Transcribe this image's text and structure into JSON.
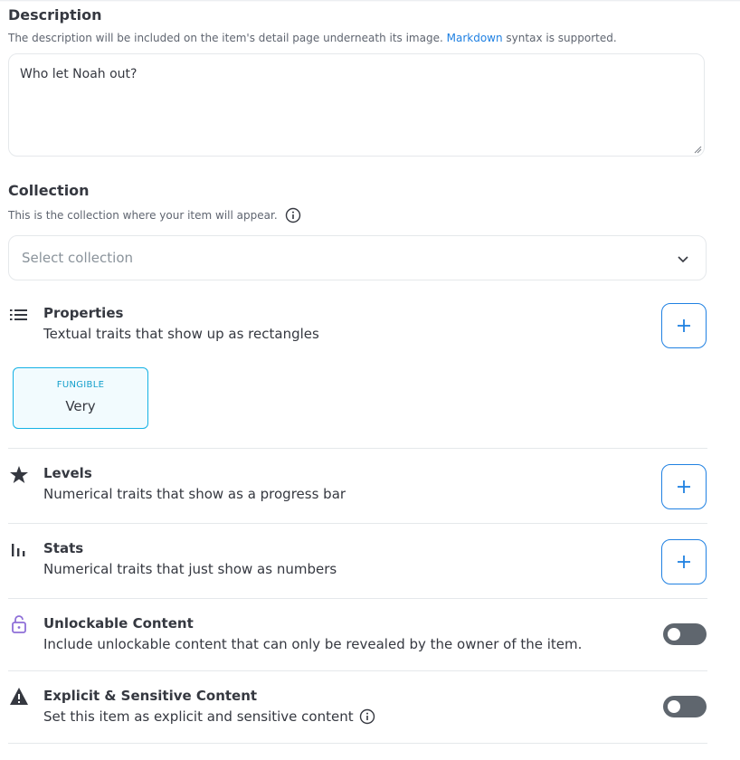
{
  "description": {
    "title": "Description",
    "helper_before_link": "The description will be included on the item's detail page underneath its image.",
    "helper_link": "Markdown",
    "helper_after_link": "syntax is supported.",
    "value": "Who let Noah out?"
  },
  "collection": {
    "title": "Collection",
    "helper": "This is the collection where your item will appear.",
    "select_placeholder": "Select collection"
  },
  "properties": {
    "title": "Properties",
    "subtitle": "Textual traits that show up as rectangles",
    "items": [
      {
        "type": "FUNGIBLE",
        "value": "Very"
      }
    ]
  },
  "levels": {
    "title": "Levels",
    "subtitle": "Numerical traits that show as a progress bar"
  },
  "stats": {
    "title": "Stats",
    "subtitle": "Numerical traits that just show as numbers"
  },
  "unlockable": {
    "title": "Unlockable Content",
    "subtitle": "Include unlockable content that can only be revealed by the owner of the item.",
    "enabled": false
  },
  "explicit": {
    "title": "Explicit & Sensitive Content",
    "subtitle": "Set this item as explicit and sensitive content",
    "enabled": false
  },
  "colors": {
    "accent": "#2081e2",
    "property_border": "#15b2e5",
    "toggle_off": "#5f666e"
  },
  "icons": {
    "properties": "list-icon",
    "levels": "star-icon",
    "stats": "bar-chart-icon",
    "unlockable": "lock-open-icon",
    "explicit": "warning-icon",
    "collection_info": "info-icon",
    "select_chevron": "chevron-down-icon",
    "add": "plus-icon"
  }
}
